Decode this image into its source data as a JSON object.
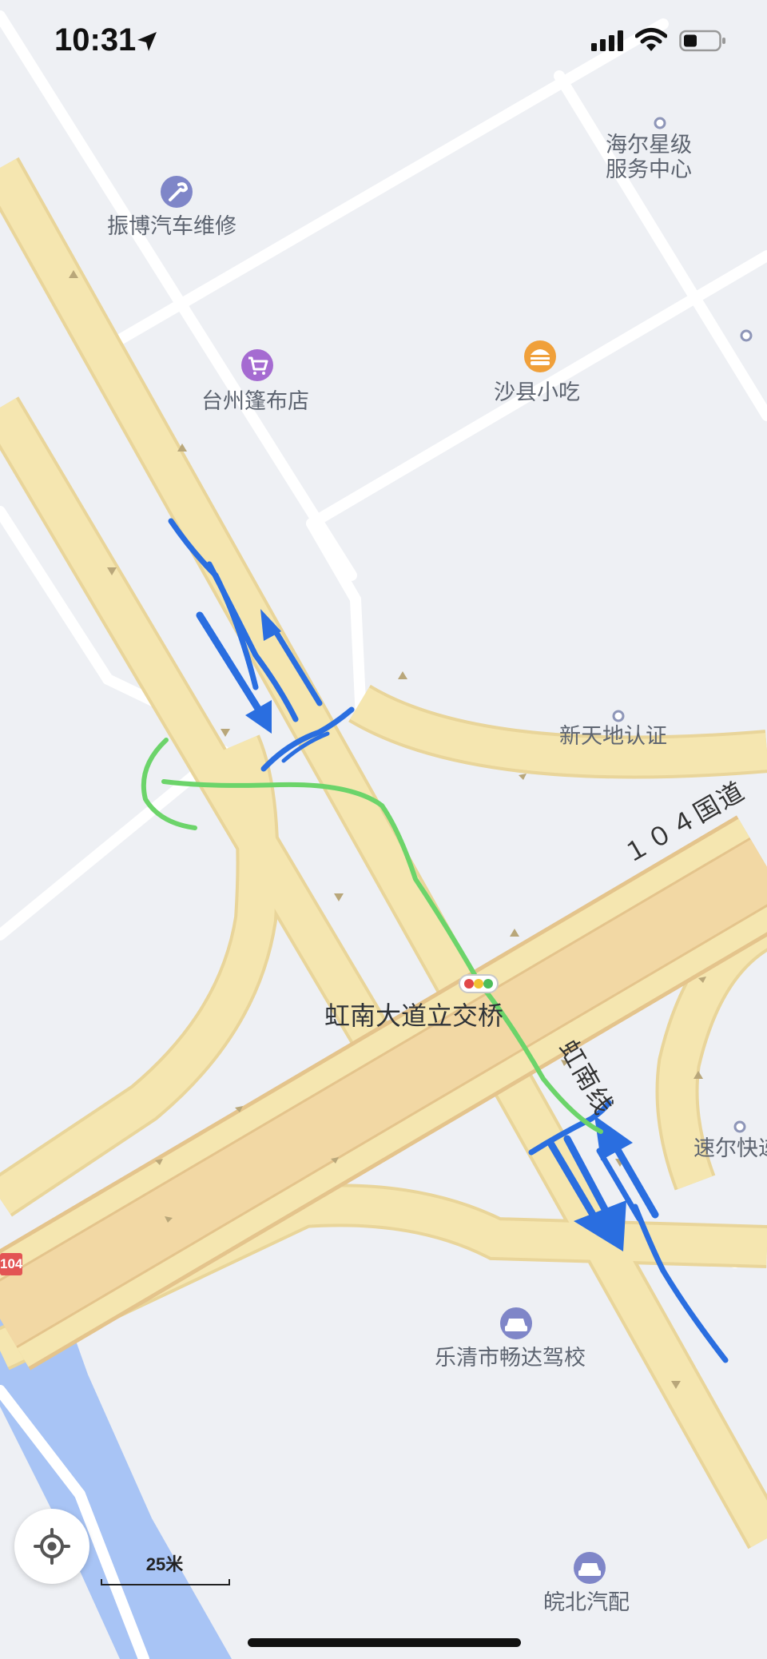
{
  "status_bar": {
    "time": "10:31",
    "icons": [
      "location-arrow-icon",
      "cellular-signal-icon",
      "wifi-icon",
      "battery-icon"
    ]
  },
  "map": {
    "pois": [
      {
        "id": "haier",
        "lines": [
          "海尔星级",
          "服务中心"
        ],
        "icon": "dot-icon"
      },
      {
        "id": "zhenbo",
        "lines": [
          "振博汽车维修"
        ],
        "icon": "wrench-icon"
      },
      {
        "id": "taizhou",
        "lines": [
          "台州篷布店"
        ],
        "icon": "shopping-cart-icon"
      },
      {
        "id": "shaxian",
        "lines": [
          "沙县小吃"
        ],
        "icon": "burger-icon"
      },
      {
        "id": "xintiandi",
        "lines": [
          "新天地认证"
        ],
        "icon": "dot-icon"
      },
      {
        "id": "suer",
        "lines": [
          "速尔快递"
        ],
        "icon": "dot-icon"
      },
      {
        "id": "changda",
        "lines": [
          "乐清市畅达驾校"
        ],
        "icon": "car-icon"
      },
      {
        "id": "wanbei",
        "lines": [
          "皖北汽配"
        ],
        "icon": "car-icon"
      }
    ],
    "interchange_label": "虹南大道立交桥",
    "road_labels": {
      "highway": "１０４国道",
      "honnan_line": "虹南线"
    },
    "route_shield": "104",
    "annotations": {
      "blue_color": "#2a6ee0",
      "green_color": "#6cd46a"
    },
    "colors": {
      "background": "#eef0f4",
      "minor_road": "#ffffff",
      "major_road": "#f5e6b0",
      "major_road_edge": "#e9d59a",
      "highway": "#f2d8a4",
      "highway_edge": "#e4c48c",
      "water": "#a8c4f5"
    }
  },
  "controls": {
    "locate_icon": "crosshair-locate-icon",
    "scale_label": "25米"
  }
}
